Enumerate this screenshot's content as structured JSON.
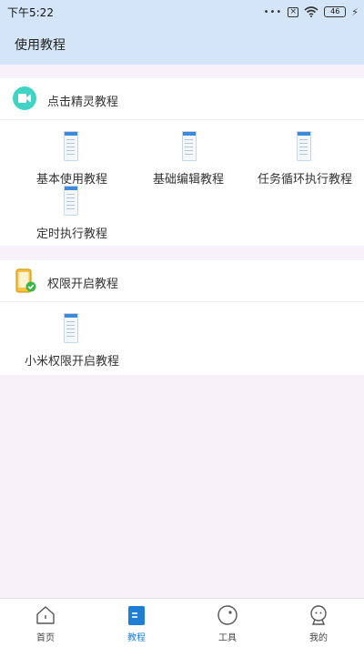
{
  "status_bar": {
    "time": "下午5:22",
    "battery": "46"
  },
  "header": {
    "title": "使用教程"
  },
  "sections": [
    {
      "label": "点击精灵教程",
      "icon": "video-camera-icon",
      "items": [
        "基本使用教程",
        "基础编辑教程",
        "任务循环执行教程",
        "定时执行教程"
      ]
    },
    {
      "label": "权限开启教程",
      "icon": "phone-check-icon",
      "items": [
        "小米权限开启教程"
      ]
    }
  ],
  "bottom_nav": [
    {
      "label": "首页",
      "icon": "home-icon",
      "active": false
    },
    {
      "label": "教程",
      "icon": "tutorial-icon",
      "active": true
    },
    {
      "label": "工具",
      "icon": "tools-icon",
      "active": false
    },
    {
      "label": "我的",
      "icon": "profile-icon",
      "active": false
    }
  ],
  "colors": {
    "accent": "#1e7ed3",
    "header_bg": "#d3e5f7",
    "video_badge": "#41d4c4"
  }
}
